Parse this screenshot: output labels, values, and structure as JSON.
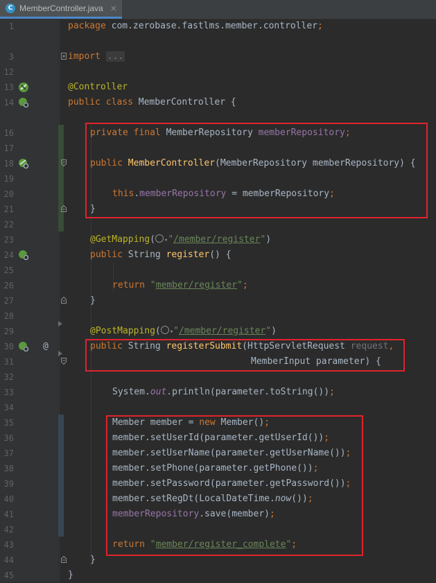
{
  "tab": {
    "icon_letter": "C",
    "file_name": "MemberController.java",
    "close": "×"
  },
  "lines": [
    {
      "n": "1"
    },
    {
      "n": "3"
    },
    {
      "n": "12"
    },
    {
      "n": "13"
    },
    {
      "n": "14"
    },
    {
      "n": "16"
    },
    {
      "n": "17"
    },
    {
      "n": "18"
    },
    {
      "n": "19"
    },
    {
      "n": "20"
    },
    {
      "n": "21"
    },
    {
      "n": "22"
    },
    {
      "n": "23"
    },
    {
      "n": "24"
    },
    {
      "n": "25"
    },
    {
      "n": "26"
    },
    {
      "n": "27"
    },
    {
      "n": "28"
    },
    {
      "n": "29"
    },
    {
      "n": "30"
    },
    {
      "n": "31"
    },
    {
      "n": "32"
    },
    {
      "n": "33"
    },
    {
      "n": "34"
    },
    {
      "n": "35"
    },
    {
      "n": "36"
    },
    {
      "n": "37"
    },
    {
      "n": "38"
    },
    {
      "n": "39"
    },
    {
      "n": "40"
    },
    {
      "n": "41"
    },
    {
      "n": "42"
    },
    {
      "n": "43"
    },
    {
      "n": "44"
    },
    {
      "n": "45"
    }
  ],
  "code": {
    "l1_kw": "package",
    "l1_rest": " com.zerobase.fastlms.member.controller",
    "l3_kw": "import",
    "l3_fold": "...",
    "l13_ann": "@Controller",
    "l14_kw": "public class",
    "l14_rest": " MemberController {",
    "l16_kw": "private final",
    "l16_type": " MemberRepository ",
    "l16_field": "memberRepository",
    "l18_kw": "public",
    "l18_fn": "MemberController",
    "l18_rest": "(MemberRepository memberRepository) {",
    "l20_this": "this",
    "l20_field": "memberRepository",
    "l20_rest": " = memberRepository",
    "brace_close": "}",
    "l23_ann": "@GetMapping",
    "l23_str_path": "/member/register",
    "l24_kw": "public",
    "l24_type": " String ",
    "l24_fn": "register",
    "l24_rest": "() {",
    "l26_kw": "return",
    "l26_str_path": "member/register",
    "l29_ann": "@PostMapping",
    "l29_str_path": "/member/register",
    "l30_kw": "public",
    "l30_type": " String ",
    "l30_fn": "registerSubmit",
    "l30_rest": "(HttpServletRequest ",
    "l30_param": "request",
    "l31_rest": "MemberInput parameter) {",
    "l33_sys": "System.",
    "l33_out": "out",
    "l33_rest": ".println(parameter.toString())",
    "l35_a": "Member member = ",
    "l35_kw": "new",
    "l35_b": " Member()",
    "l36": "member.setUserId(parameter.getUserId())",
    "l37": "member.setUserName(parameter.getUserName())",
    "l38": "member.setPhone(parameter.getPhone())",
    "l39": "member.setPassword(parameter.getPassword())",
    "l40_a": "member.setRegDt(LocalDateTime.",
    "l40_now": "now",
    "l40_b": "())",
    "l41_field": "memberRepository",
    "l41_rest": ".save(member)",
    "l43_kw": "return",
    "l43_str_path": "member/register_complete",
    "semi": ";",
    "comma": ",",
    "quote": "\"",
    "paren_open": "(",
    "paren_close": ")",
    "at_symbol": "@"
  },
  "colors": {
    "keyword": "#cc7832",
    "annotation": "#bbb529",
    "field": "#9876aa",
    "method": "#ffc66d",
    "string": "#6a8759",
    "text": "#a9b7c6",
    "highlight_box": "#e0232d"
  }
}
